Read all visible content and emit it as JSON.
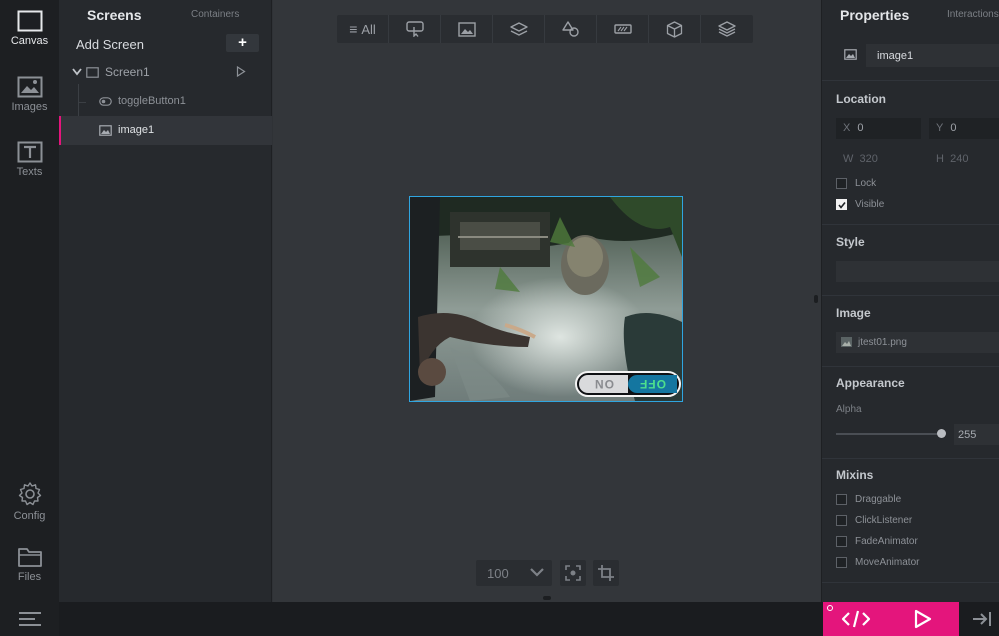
{
  "rail": {
    "items": [
      {
        "label": "Canvas",
        "icon": "canvas-icon",
        "active": true
      },
      {
        "label": "Images",
        "icon": "images-icon"
      },
      {
        "label": "Texts",
        "icon": "texts-icon"
      },
      {
        "label": "Config",
        "icon": "gear-icon"
      },
      {
        "label": "Files",
        "icon": "folder-icon"
      }
    ]
  },
  "tree": {
    "tab_screens": "Screens",
    "tab_containers": "Containers",
    "add_screen": "Add Screen",
    "add_symbol": "+",
    "screen_name": "Screen1",
    "children": [
      "toggleButton1",
      "image1"
    ]
  },
  "toolbar": {
    "all_label": "All",
    "buttons": [
      "interaction-icon",
      "image-icon",
      "container-icon",
      "shapes-icon",
      "widget-icon",
      "3d-icon",
      "stack-icon"
    ]
  },
  "stage": {
    "toggle_on": "ON",
    "toggle_off": "OFF"
  },
  "zoom": {
    "value": "100"
  },
  "props": {
    "title": "Properties",
    "tab2": "Interactions",
    "name": "image1",
    "location_title": "Location",
    "x_key": "X",
    "x_val": "0",
    "y_key": "Y",
    "y_val": "0",
    "w_key": "W",
    "w_val": "320",
    "h_key": "H",
    "h_val": "240",
    "lock": "Lock",
    "visible": "Visible",
    "style_title": "Style",
    "image_title": "Image",
    "image_file": "jtest01.png",
    "appearance_title": "Appearance",
    "alpha_label": "Alpha",
    "alpha_value": "255",
    "alpha_fraction": 1.0,
    "mixins_title": "Mixins",
    "mixins": [
      "Draggable",
      "ClickListener",
      "FadeAnimator",
      "MoveAnimator"
    ]
  },
  "colors": {
    "accent": "#e4157c",
    "selection": "#2fa5e0",
    "toggle_off_bg": "#1476a0",
    "toggle_off_text": "#4ee08c"
  }
}
